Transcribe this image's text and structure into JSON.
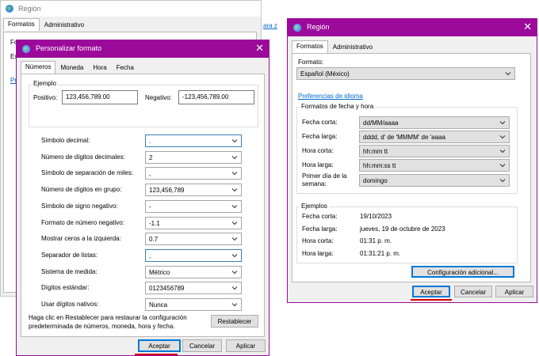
{
  "background_window": {
    "title": "Región",
    "tabs": [
      "Formatos",
      "Administrativo"
    ],
    "fragments": {
      "f": "Fo",
      "e": "Es",
      "link": "Pref",
      "right_link": "ara z"
    }
  },
  "custom_format_dialog": {
    "title": "Personalizar formato",
    "close": "✕",
    "tabs": [
      "Números",
      "Moneda",
      "Hora",
      "Fecha"
    ],
    "example_group": "Ejemplo",
    "positive_label": "Positivo:",
    "positive_value": "123,456,789.00",
    "negative_label": "Negativo:",
    "negative_value": "-123,456,789.00",
    "settings": [
      {
        "label": "Símbolo decimal:",
        "value": "."
      },
      {
        "label": "Número de dígitos decimales:",
        "value": "2"
      },
      {
        "label": "Símbolo de separación de miles:",
        "value": ","
      },
      {
        "label": "Número de dígitos en grupo:",
        "value": "123,456,789"
      },
      {
        "label": "Símbolo de signo negativo:",
        "value": "-"
      },
      {
        "label": "Formato de número negativo:",
        "value": "-1.1"
      },
      {
        "label": "Mostrar ceros a la izquierda:",
        "value": "0.7"
      },
      {
        "label": "Separador de listas:",
        "value": ","
      },
      {
        "label": "Sistema de medida:",
        "value": "Métrico"
      },
      {
        "label": "Dígitos estándar:",
        "value": "0123456789"
      },
      {
        "label": "Usar dígitos nativos:",
        "value": "Nunca"
      }
    ],
    "footer_text_1": "Haga clic en Restablecer para restaurar la configuración",
    "footer_text_2": "predeterminada de números, moneda, hora y fecha.",
    "reset": "Restablecer",
    "ok": "Aceptar",
    "cancel": "Cancelar",
    "apply": "Aplicar"
  },
  "region_dialog": {
    "title": "Región",
    "close": "✕",
    "tabs": [
      "Formatos",
      "Administrativo"
    ],
    "format_label": "Formato:",
    "format_value": "Español (México)",
    "lang_prefs": "Preferencias de idioma",
    "datetime_group": "Formatos de fecha y hora",
    "datetime": [
      {
        "label": "Fecha corta:",
        "value": "dd/MM/aaaa"
      },
      {
        "label": "Fecha larga:",
        "value": "dddd, d' de 'MMMM' de 'aaaa"
      },
      {
        "label": "Hora corta:",
        "value": "hh:mm tt"
      },
      {
        "label": "Hora larga:",
        "value": "hh:mm:ss tt"
      }
    ],
    "first_day_label_1": "Primer día de la",
    "first_day_label_2": "semana:",
    "first_day_value": "domingo",
    "examples_group": "Ejemplos",
    "examples": [
      {
        "label": "Fecha corta:",
        "value": "19/10/2023"
      },
      {
        "label": "Fecha larga:",
        "value": "jueves, 19 de octubre de 2023"
      },
      {
        "label": "Hora corta:",
        "value": "01:31 p. m."
      },
      {
        "label": "Hora larga:",
        "value": "01:31:21 p. m."
      }
    ],
    "additional_config": "Configuración adicional...",
    "ok": "Aceptar",
    "cancel": "Cancelar",
    "apply": "Aplicar"
  },
  "colors": {
    "titlebar": "#9b0a9b",
    "underline": "#d40000",
    "link": "#0066cc"
  }
}
